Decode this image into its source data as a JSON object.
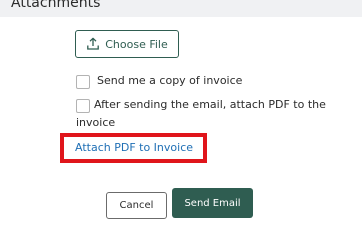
{
  "section": {
    "title": "Attachments"
  },
  "upload": {
    "choose_file_label": "Choose File",
    "icon": "upload-icon"
  },
  "options": {
    "send_copy_label": "Send me a copy of invoice",
    "send_copy_checked": false,
    "attach_after_send_line1": "After sending the email, attach PDF to the",
    "attach_after_send_line2": "invoice",
    "attach_after_send_checked": false
  },
  "links": {
    "attach_pdf_label": "Attach PDF to Invoice"
  },
  "actions": {
    "cancel_label": "Cancel",
    "send_label": "Send Email"
  },
  "colors": {
    "brand": "#2f5d51",
    "link": "#1f6fb5",
    "highlight": "#e0151b",
    "header_bg": "#f0f1f3"
  }
}
